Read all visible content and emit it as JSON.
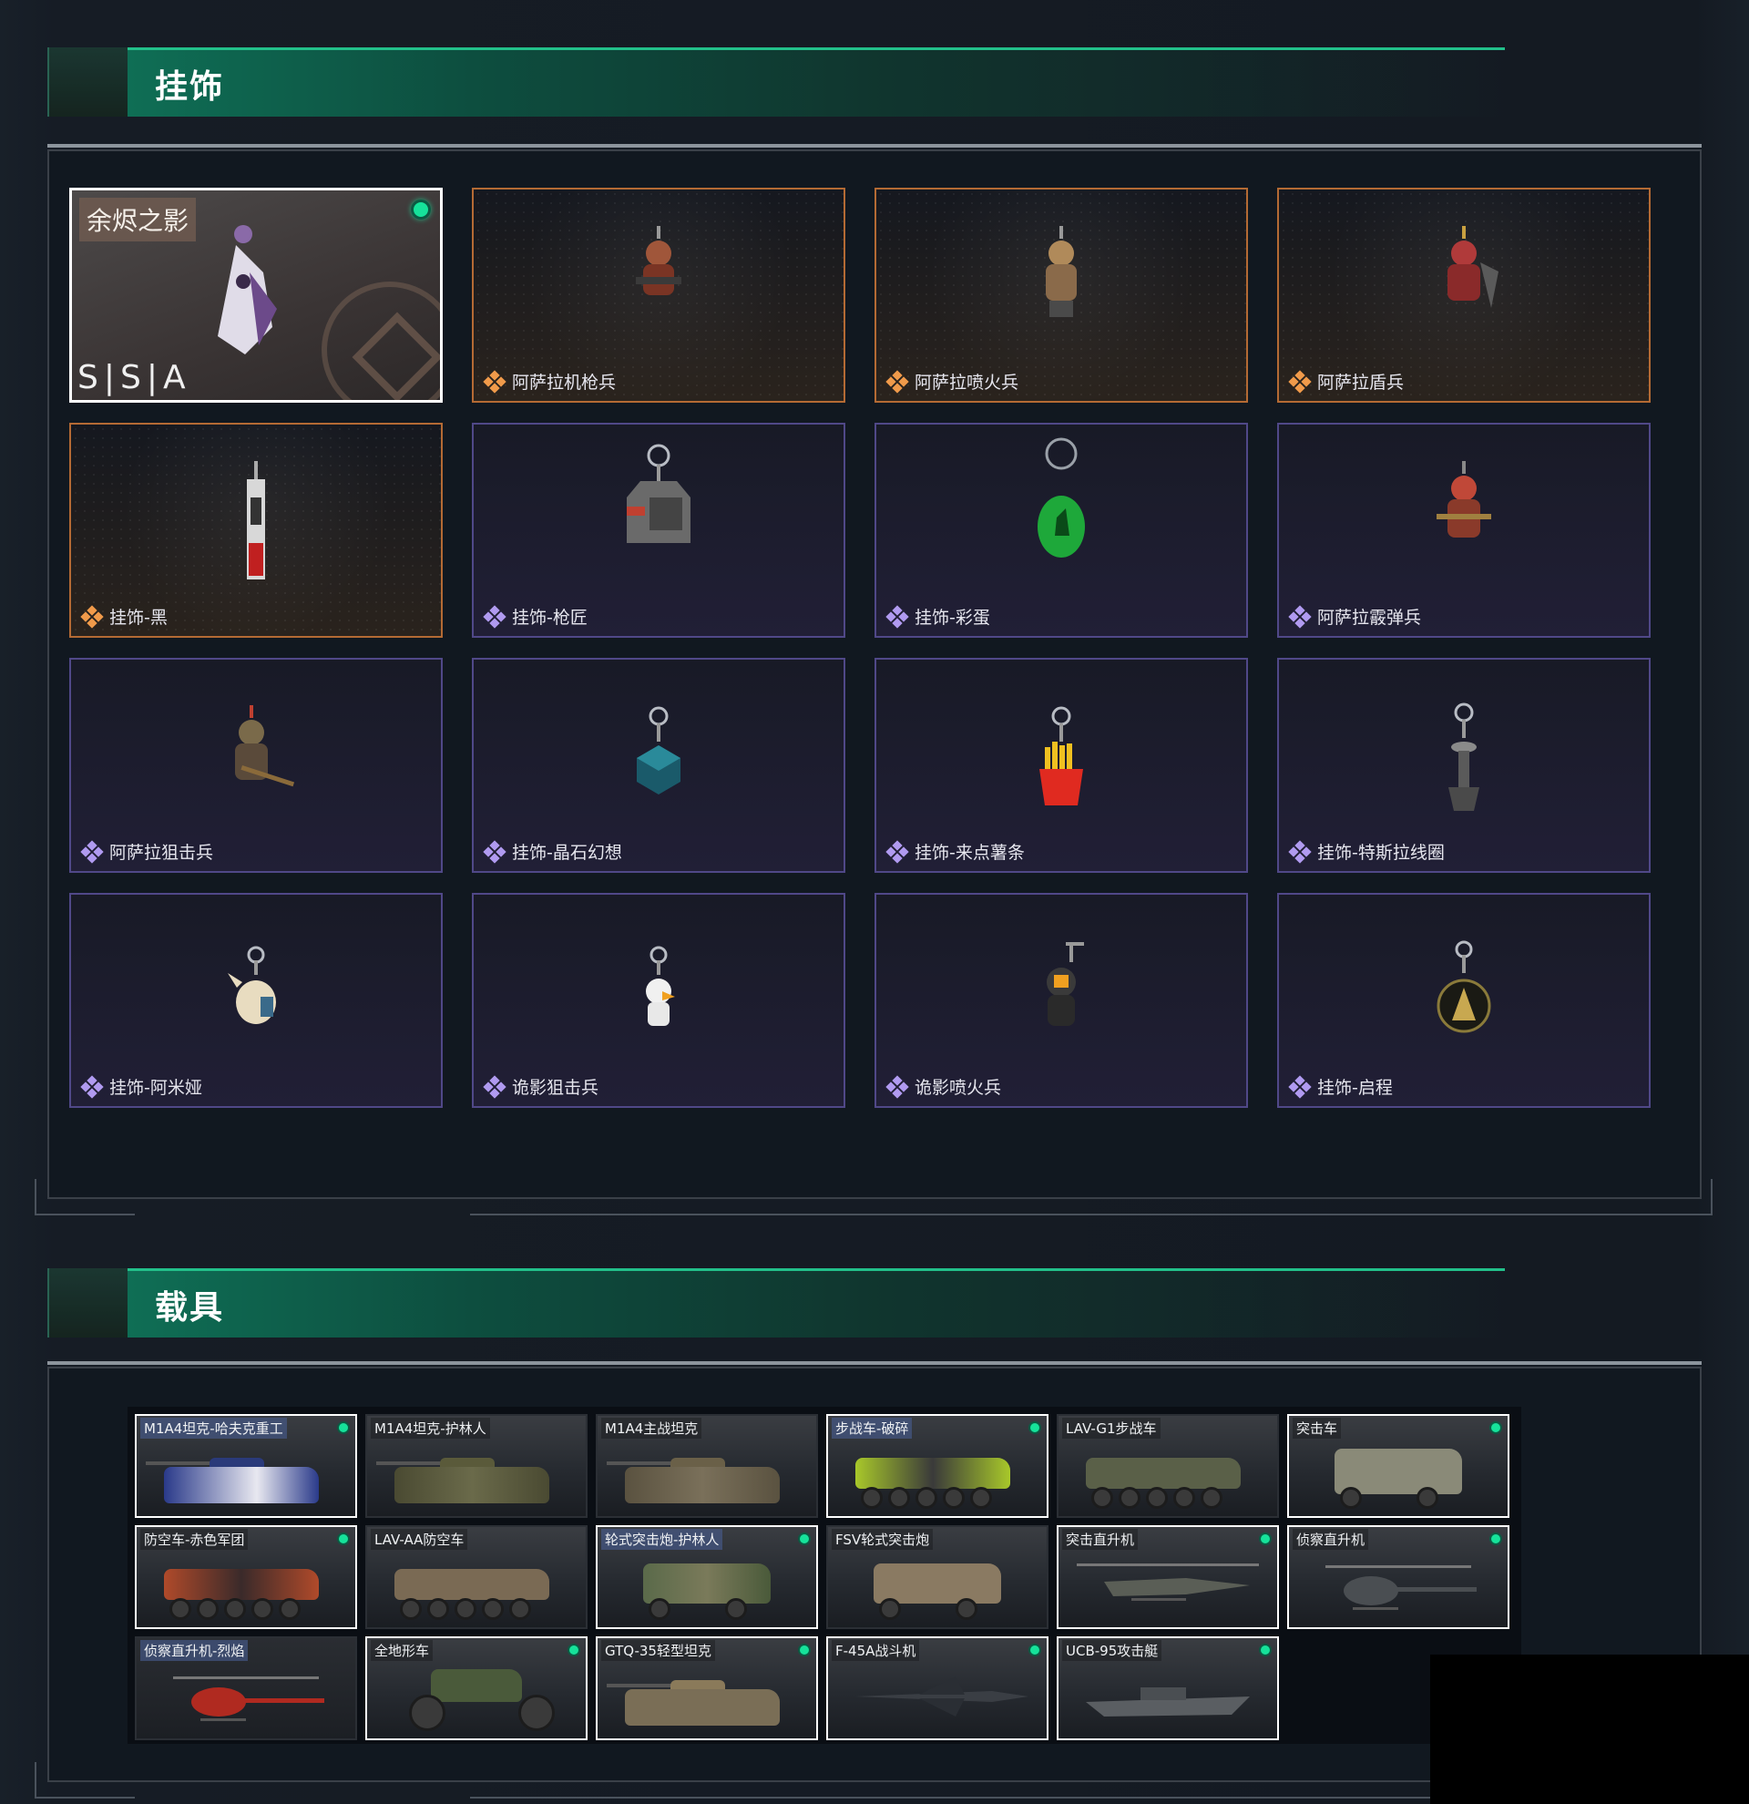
{
  "sections": {
    "charms": {
      "title": "挂饰"
    },
    "vehicles": {
      "title": "载具"
    }
  },
  "featured_charm": {
    "title": "余烬之影",
    "brand": "S|S|A",
    "owned": true
  },
  "charms": [
    {
      "name": "阿萨拉机枪兵",
      "rarity": "gold"
    },
    {
      "name": "阿萨拉喷火兵",
      "rarity": "gold"
    },
    {
      "name": "阿萨拉盾兵",
      "rarity": "gold"
    },
    {
      "name": "挂饰-黑",
      "rarity": "gold"
    },
    {
      "name": "挂饰-枪匠",
      "rarity": "purple"
    },
    {
      "name": "挂饰-彩蛋",
      "rarity": "purple"
    },
    {
      "name": "阿萨拉霰弹兵",
      "rarity": "purple"
    },
    {
      "name": "阿萨拉狙击兵",
      "rarity": "purple"
    },
    {
      "name": "挂饰-晶石幻想",
      "rarity": "purple"
    },
    {
      "name": "挂饰-来点薯条",
      "rarity": "purple"
    },
    {
      "name": "挂饰-特斯拉线圈",
      "rarity": "purple"
    },
    {
      "name": "挂饰-阿米娅",
      "rarity": "purple"
    },
    {
      "name": "诡影狙击兵",
      "rarity": "purple"
    },
    {
      "name": "诡影喷火兵",
      "rarity": "purple"
    },
    {
      "name": "挂饰-启程",
      "rarity": "purple"
    }
  ],
  "vehicles": [
    {
      "name": "M1A4坦克-哈夫克重工",
      "owned": true,
      "tag": true
    },
    {
      "name": "M1A4坦克-护林人",
      "owned": false
    },
    {
      "name": "M1A4主战坦克",
      "owned": false
    },
    {
      "name": "步战车-破碎",
      "owned": true,
      "tag": true
    },
    {
      "name": "LAV-G1步战车",
      "owned": false
    },
    {
      "name": "突击车",
      "owned": true
    },
    {
      "name": "防空车-赤色军团",
      "owned": true
    },
    {
      "name": "LAV-AA防空车",
      "owned": false
    },
    {
      "name": "轮式突击炮-护林人",
      "owned": true,
      "tag": true
    },
    {
      "name": "FSV轮式突击炮",
      "owned": false
    },
    {
      "name": "突击直升机",
      "owned": true
    },
    {
      "name": "侦察直升机",
      "owned": true
    },
    {
      "name": "侦察直升机-烈焰",
      "owned": false,
      "tag": true
    },
    {
      "name": "全地形车",
      "owned": true
    },
    {
      "name": "GTQ-35轻型坦克",
      "owned": true
    },
    {
      "name": "F-45A战斗机",
      "owned": true
    },
    {
      "name": "UCB-95攻击艇",
      "owned": true
    }
  ],
  "colors": {
    "accent_green": "#16e29a",
    "rarity_gold": "#f09a4a",
    "rarity_purple": "#b09af0"
  }
}
